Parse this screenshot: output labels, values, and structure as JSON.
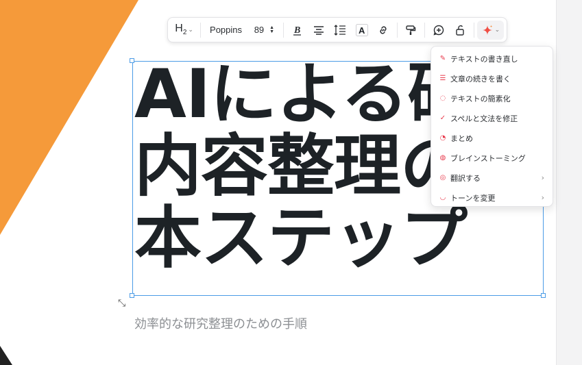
{
  "toolbar": {
    "heading_label": "H",
    "heading_level": "2",
    "font_name": "Poppins",
    "font_size": "89"
  },
  "title_lines": [
    "AIによる研",
    "内容整理の",
    "本ステップ"
  ],
  "subtitle": "効率的な研究整理のための手順",
  "ai_menu": {
    "items": [
      {
        "label": "テキストの書き直し",
        "icon": "pen-sparkle-icon",
        "has_submenu": false
      },
      {
        "label": "文章の続きを書く",
        "icon": "lines-icon",
        "has_submenu": false
      },
      {
        "label": "テキストの簡素化",
        "icon": "simplify-icon",
        "has_submenu": false
      },
      {
        "label": "スペルと文法を修正",
        "icon": "spellcheck-icon",
        "has_submenu": false
      },
      {
        "label": "まとめ",
        "icon": "summary-icon",
        "has_submenu": false
      },
      {
        "label": "ブレインストーミング",
        "icon": "brain-icon",
        "has_submenu": false
      },
      {
        "label": "翻訳する",
        "icon": "translate-icon",
        "has_submenu": true
      },
      {
        "label": "トーンを変更",
        "icon": "tone-icon",
        "has_submenu": true
      }
    ]
  },
  "colors": {
    "accent_orange": "#f59a3a",
    "selection_blue": "#4a9be6",
    "menu_icon_red": "#e8394b",
    "title_text": "#1d2226"
  }
}
